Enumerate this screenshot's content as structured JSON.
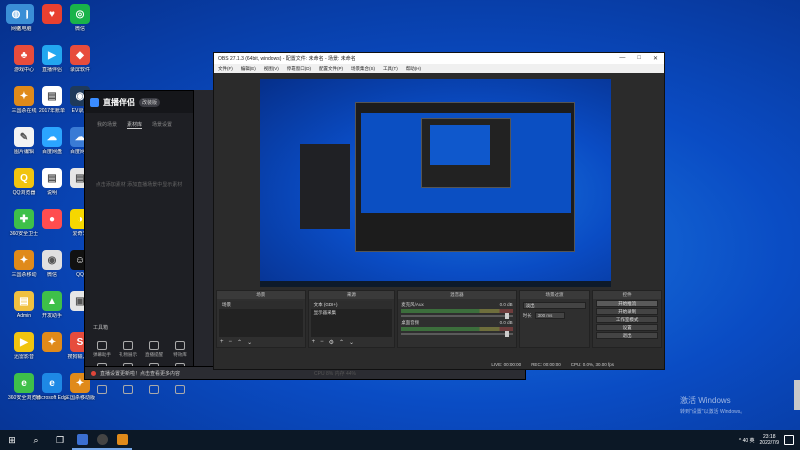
{
  "desktop": {
    "icons": [
      {
        "label": "此电脑",
        "color": "#3a8ed6",
        "glyph": "▣"
      },
      {
        "label": "游戏中心",
        "color": "#e74c3c",
        "glyph": "♣"
      },
      {
        "label": "三国杀在线",
        "color": "#e08a1a",
        "glyph": "✦"
      },
      {
        "label": "图片编辑",
        "color": "#f3f3f3",
        "glyph": "✎"
      },
      {
        "label": "QQ浏览器",
        "color": "#f1c40f",
        "glyph": "Q"
      },
      {
        "label": "360安全卫士",
        "color": "#3ec04a",
        "glyph": "✚"
      },
      {
        "label": "三国杀移动",
        "color": "#e08a1a",
        "glyph": "✦"
      },
      {
        "label": "Admin",
        "color": "#f0c040",
        "glyph": "▤"
      },
      {
        "label": "迅雷影音",
        "color": "#f1c40f",
        "glyph": "▶"
      },
      {
        "label": "360安全浏览器",
        "color": "#3ec04a",
        "glyph": "e"
      },
      {
        "label": "",
        "color": "#e84030",
        "glyph": "♥"
      },
      {
        "label": "直播伴侣",
        "color": "#22a7f0",
        "glyph": "▶"
      },
      {
        "label": "2017年账单",
        "color": "#ffffff",
        "glyph": "▤"
      },
      {
        "label": "百度网盘",
        "color": "#2ba5ff",
        "glyph": "☁"
      },
      {
        "label": "说明",
        "color": "#ffffff",
        "glyph": "▤"
      },
      {
        "label": "",
        "color": "#ff4d4f",
        "glyph": "●"
      },
      {
        "label": "微信",
        "color": "#e0e0e0",
        "glyph": "◉"
      },
      {
        "label": "开发助手",
        "color": "#3ec04a",
        "glyph": "▲"
      },
      {
        "label": "",
        "color": "#e08a1a",
        "glyph": "✦"
      },
      {
        "label": "Microsoft Edge",
        "color": "#1e88e5",
        "glyph": "e"
      },
      {
        "label": "微信",
        "color": "#19b34a",
        "glyph": "◎"
      },
      {
        "label": "录屏软件",
        "color": "#e74c3c",
        "glyph": "◆"
      },
      {
        "label": "EV录屏",
        "color": "#1f3a5a",
        "glyph": "◉"
      },
      {
        "label": "百度网盘",
        "color": "#3a7bd5",
        "glyph": "☁"
      },
      {
        "label": "",
        "color": "#e6e6e6",
        "glyph": "▤"
      },
      {
        "label": "爱奇艺",
        "color": "#f6d700",
        "glyph": "◑"
      },
      {
        "label": "QQ",
        "color": "#111111",
        "glyph": "☺"
      },
      {
        "label": "",
        "color": "#e6e6e6",
        "glyph": "▣"
      },
      {
        "label": "搜狗输入法",
        "color": "#e74c3c",
        "glyph": "S"
      },
      {
        "label": "三国杀移动版",
        "color": "#e08a1a",
        "glyph": "✦"
      },
      {
        "label": "网络",
        "color": "#3a8ed6",
        "glyph": "◍"
      }
    ]
  },
  "streamer": {
    "title": "直播伴侣",
    "badge": "改装版",
    "tabs": [
      "我的场景",
      "素材库",
      "场景设置"
    ],
    "empty_text": "点击添加素材 添加直播场景中显示素材",
    "tools_title": "工具箱",
    "tools": [
      "弹幕助手",
      "礼物展示",
      "直播提醒",
      "特效库",
      "录屏",
      "多人连麦",
      "数据中心",
      "音乐",
      "",
      "",
      "",
      ""
    ],
    "bottom_notice": "直播设置更新啦！点击查看更多内容",
    "bottom_meta": "CPU 8%  内存 44%"
  },
  "obs": {
    "title": "OBS 27.1.3 (64bit, windows) - 配置文件: 未命名 - 场景: 未命名",
    "menu": [
      "文件(F)",
      "编辑(E)",
      "视图(V)",
      "停靠窗口(D)",
      "配置文件(P)",
      "场景集合(S)",
      "工具(T)",
      "帮助(H)"
    ],
    "window_controls": [
      "—",
      "□",
      "✕"
    ],
    "docks": {
      "scenes": {
        "header": "场景",
        "items": [
          "场景"
        ]
      },
      "sources": {
        "header": "来源",
        "items": [
          "文本 (GDI+)",
          "显示器采集"
        ]
      },
      "mixer": {
        "header": "混音器",
        "channels": [
          {
            "name": "麦克风/Aux",
            "level": "0.0 dB"
          },
          {
            "name": "桌面音频",
            "level": "0.0 dB"
          }
        ]
      },
      "transitions": {
        "header": "场景过渡",
        "select": "淡出",
        "duration_label": "时长",
        "duration": "300 ms"
      },
      "controls": {
        "header": "控件",
        "buttons": [
          "开始推流",
          "开始录制",
          "工作室模式",
          "设置",
          "退出"
        ]
      }
    },
    "status": {
      "live": "LIVE: 00:00:00",
      "rec": "REC: 00:00:00",
      "cpu": "CPU: 0.0%, 30.00 fps"
    }
  },
  "activation": {
    "line1": "激活 Windows",
    "line2": "转到\"设置\"以激活 Windows。"
  },
  "taskbar": {
    "time": "23:18",
    "date": "2022/7/9",
    "tray_text": "^ 40 英"
  }
}
